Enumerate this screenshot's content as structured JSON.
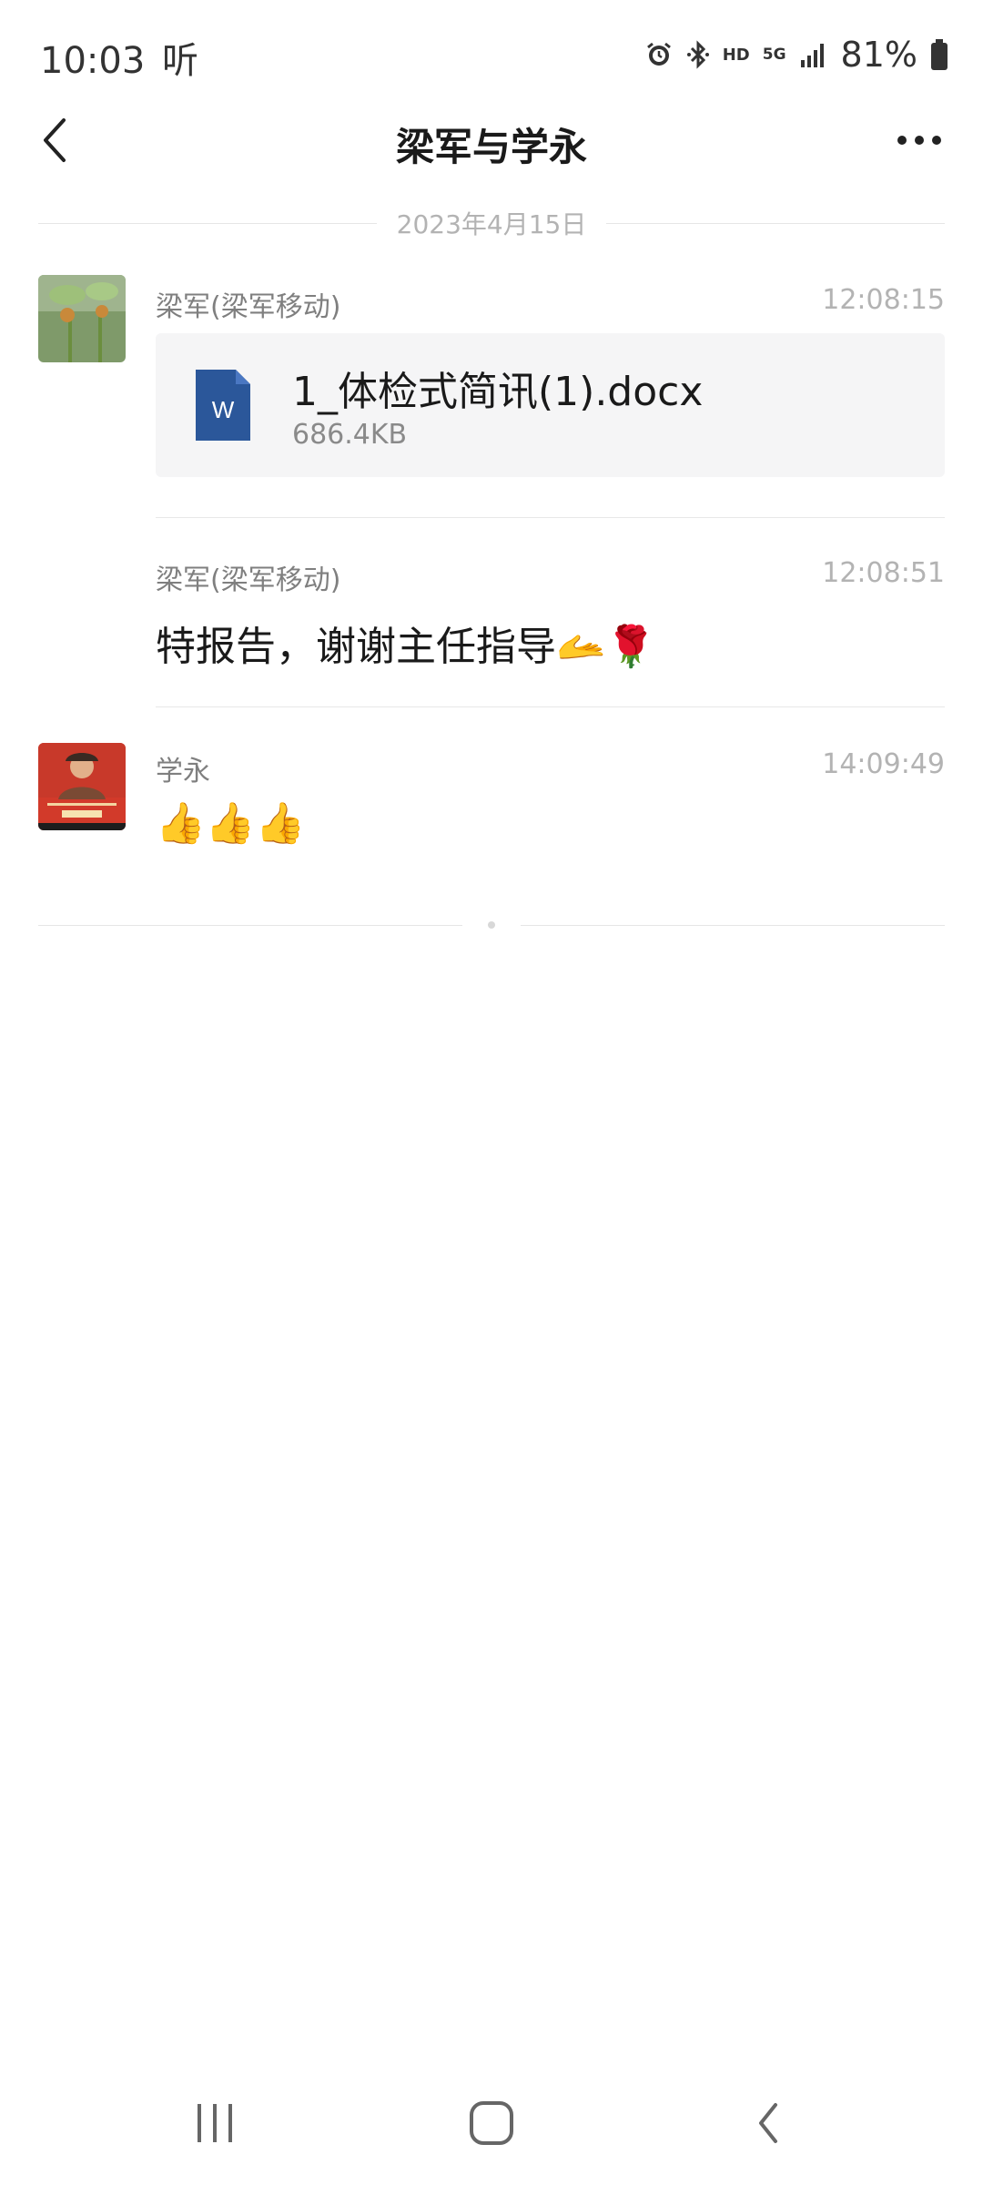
{
  "status_bar": {
    "time": "10:03",
    "time_suffix": "听",
    "hd": "HD",
    "network": "5G",
    "battery_percent": "81%"
  },
  "header": {
    "title": "梁军与学永"
  },
  "date_divider": "2023年4月15日",
  "messages": [
    {
      "sender": "梁军(梁军移动)",
      "time": "12:08:15",
      "file": {
        "name": "1_体检式简讯(1).docx",
        "size": "686.4KB",
        "icon_letter": "W"
      }
    },
    {
      "sender": "梁军(梁军移动)",
      "time": "12:08:51",
      "text": "特报告，谢谢主任指导🫴🌹"
    },
    {
      "sender": "学永",
      "time": "14:09:49",
      "text": "👍👍👍"
    }
  ],
  "colors": {
    "accent_word_blue": "#2b579a",
    "divider": "#e6e6e6",
    "card_bg": "#f5f5f6"
  }
}
